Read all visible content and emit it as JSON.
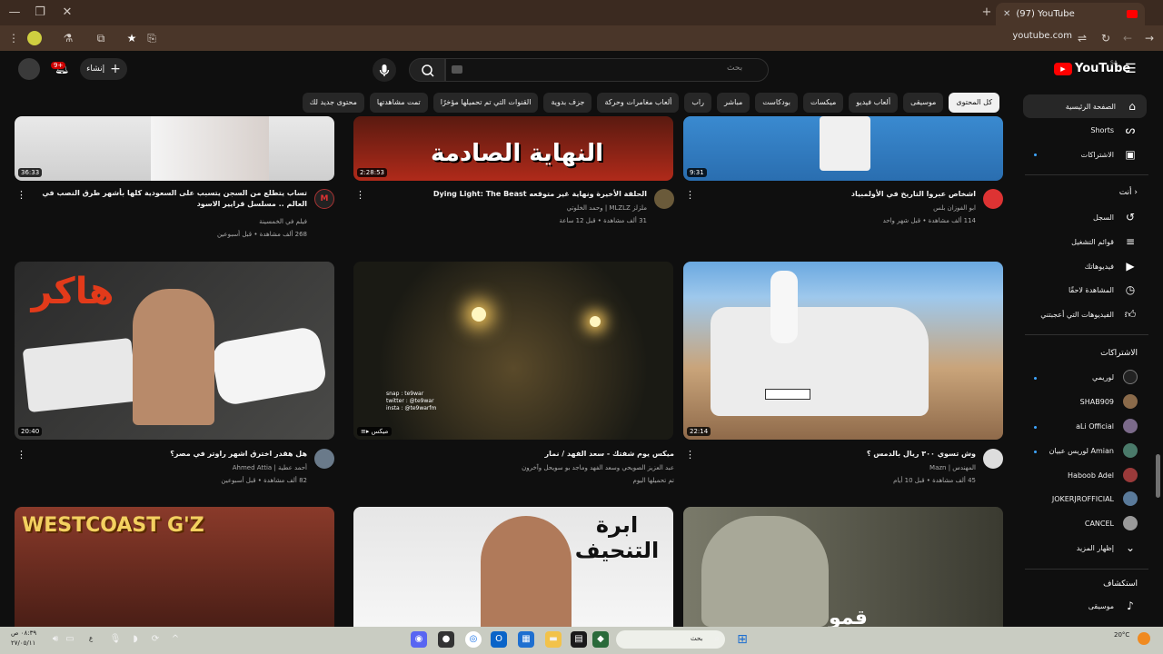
{
  "browser": {
    "tab_title": "(97) YouTube",
    "url": "youtube.com",
    "new_tab_icon": "plus-icon",
    "close_tab_icon": "close-icon"
  },
  "header": {
    "logo_text": "YouTube",
    "region": "SA",
    "search_placeholder": "بحث",
    "create_label": "إنشاء",
    "notif_count": "9+"
  },
  "chips": [
    "كل المحتوى",
    "موسيقى",
    "ألعاب فيديو",
    "ميكسات",
    "بودكاست",
    "مباشر",
    "راب",
    "ألعاب مغامرات وحركة",
    "جزف بدوية",
    "القنوات التي تم تحميلها مؤخرًا",
    "تمت مشاهدتها",
    "محتوى جديد لك"
  ],
  "sidebar": {
    "main": [
      {
        "label": "الصفحة الرئيسية",
        "icon": "home-icon"
      },
      {
        "label": "Shorts",
        "icon": "shorts-icon"
      },
      {
        "label": "الاشتراكات",
        "icon": "subscriptions-icon"
      }
    ],
    "you_header": "أنت",
    "you": [
      {
        "label": "السجل",
        "icon": "history-icon"
      },
      {
        "label": "قوائم التشغيل",
        "icon": "playlist-icon"
      },
      {
        "label": "فيديوهاتك",
        "icon": "your-videos-icon"
      },
      {
        "label": "المشاهدة لاحقًا",
        "icon": "watch-later-icon"
      },
      {
        "label": "الفيديوهات التي أعجبتني",
        "icon": "like-icon"
      }
    ],
    "subs_header": "الاشتراكات",
    "subs": [
      {
        "label": "لوريمي"
      },
      {
        "label": "SHAB909"
      },
      {
        "label": "aLi Official"
      },
      {
        "label": "لوريس عبيان Amian"
      },
      {
        "label": "Haboob Adel"
      },
      {
        "label": "JOKERJROFFICIAL"
      },
      {
        "label": "CANCEL"
      }
    ],
    "show_more": "إظهار المزيد",
    "explore_header": "استكشاف",
    "explore_music": "موسيقى"
  },
  "videos": [
    {
      "title": "تساب يتطلع من السجن يتسبب على السعودية كلها بأشهر طرق النصب في العالم .. مسلسل قرايير الاسود",
      "channel": "فيلم في الخمسينة",
      "meta": "268 ألف مشاهدة • قبل أسبوعين",
      "duration": "36:33"
    },
    {
      "title": "الحلقة الأخيرة ونهاية غير متوقعه Dying Light: The Beast",
      "channel": "ملزلز MLZLZ | وحمد الخلوتي",
      "meta": "31 ألف مشاهدة • قبل 12 ساعة",
      "duration": "2:28:53",
      "thumb_text": "النهاية الصادمة"
    },
    {
      "title": "اشخاص عبروا التاريخ في الأولمبياد",
      "channel": "ابو الفوزان بلس",
      "meta": "114 ألف مشاهدة • قبل شهر واحد",
      "duration": "9:31"
    },
    {
      "title": "هل هقدر اخترق اشهر راوتر في مصر؟",
      "channel": "أحمد عطية | Ahmed Attia",
      "meta": "82 ألف مشاهدة • قبل أسبوعين",
      "duration": "20:40",
      "thumb_text": "هاكر"
    },
    {
      "title": "ميكس يوم شفتك - سعد الفهد / نمار",
      "channel": "عبد العزيز الصويحي وسعد الفهد وماجد بو سويحل وآخرون",
      "meta": "تم تحميلها اليوم",
      "duration": "ميكس",
      "overlay": "snap : te9war\ntwitter : @te9war\ninsta : @te9warfm"
    },
    {
      "title": "وش تسوي ٣٠٠ ريال بالدمس ؟",
      "channel": "المهندس | Mazn",
      "meta": "45 ألف مشاهدة • قبل 10 أيام",
      "duration": "22:14"
    },
    {
      "title": "",
      "channel": "",
      "meta": "",
      "duration": "",
      "thumb_text": "WESTCOAST G'Z"
    },
    {
      "title": "",
      "channel": "",
      "meta": "",
      "duration": "",
      "thumb_text": "ابرة التنحيف"
    },
    {
      "title": "",
      "channel": "",
      "meta": "",
      "duration": "",
      "thumb_text": "قمو"
    }
  ],
  "taskbar": {
    "time": "٠٨:٣٩ ص",
    "date": "٢٧/٠٥/١١",
    "search_label": "بحث",
    "lang": "ع",
    "weather_temp": "20°C"
  }
}
